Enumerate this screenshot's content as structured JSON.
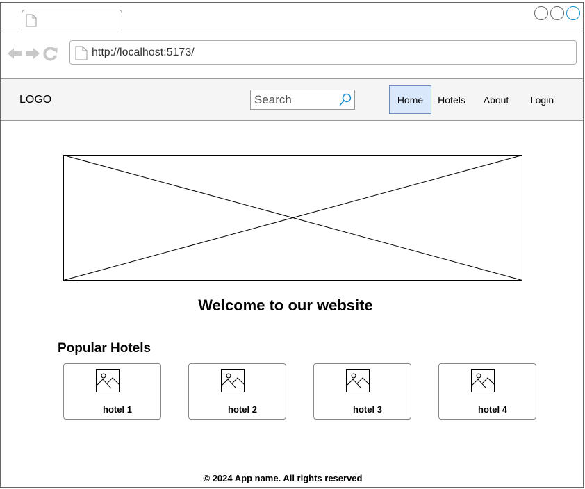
{
  "browser": {
    "url": "http://localhost:5173/",
    "icons": [
      "back-arrow-icon",
      "forward-arrow-icon",
      "refresh-icon",
      "page-icon"
    ]
  },
  "header": {
    "logo": "LOGO",
    "search_placeholder": "Search",
    "nav": [
      {
        "label": "Home",
        "active": true
      },
      {
        "label": "Hotels",
        "active": false
      },
      {
        "label": "About",
        "active": false
      },
      {
        "label": "Login",
        "active": false
      }
    ]
  },
  "main": {
    "welcome_title": "Welcome to our website",
    "popular_title": "Popular Hotels",
    "hotels": [
      {
        "label": "hotel 1"
      },
      {
        "label": "hotel 2"
      },
      {
        "label": "hotel 3"
      },
      {
        "label": "hotel 4"
      }
    ]
  },
  "footer": {
    "text": "© 2024 App name. All rights reserved"
  },
  "colors": {
    "active_nav_bg": "#dae8fc",
    "active_nav_border": "#6c8ebf",
    "accent": "#1a8ccc"
  }
}
